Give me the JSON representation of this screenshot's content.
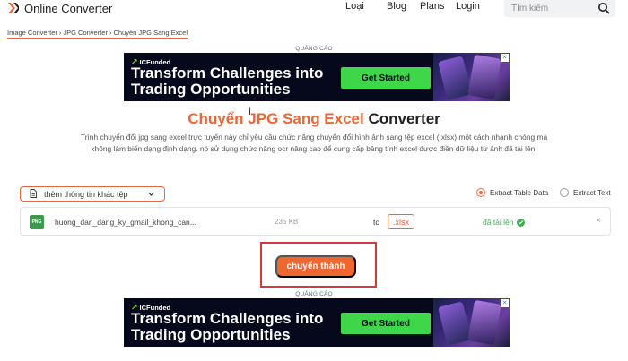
{
  "header": {
    "logo_text": "Online Converter",
    "nav": [
      "Loại",
      "Blog",
      "Plans",
      "Login"
    ],
    "search_placeholder": "Tìm kiếm"
  },
  "breadcrumb": [
    "Image Converter",
    "JPG Converter",
    "Chuyển JPG Sang Excel"
  ],
  "ads": {
    "label": "QUẢNG CÁO",
    "brand": "ICFunded",
    "headline": "Transform Challenges into Trading Opportunities",
    "cta": "Get Started",
    "close_glyph": "✕"
  },
  "title": {
    "accent": "Chuyển JPG Sang Excel",
    "rest": "Converter"
  },
  "description": "Trình chuyển đổi jpg sang excel trực tuyến này chỉ yêu cầu chức năng chuyển đổi hình ảnh sang tệp excel (.xlsx) một cách nhanh chóng mà không làm biến dạng định dạng. nó sử dụng chức năng ocr nâng cao để cung cấp bảng tính excel được điền dữ liệu từ ảnh đã tải lên.",
  "options": {
    "more_info_label": "thêm thông tin khác tệp",
    "extract_table": "Extract Table Data",
    "extract_text": "Extract Text",
    "selected": "Extract Table Data"
  },
  "file": {
    "type_badge": "PNG",
    "name": "huong_dan_dang_ky_gmail_khong_can...",
    "size": "235 KB",
    "to_label": "to",
    "target_format": ".xlsx",
    "status": "đã tải lên",
    "remove_glyph": "×"
  },
  "convert_label": "chuyển thành",
  "colors": {
    "accent": "#e8673a",
    "button": "#ed672f",
    "success": "#3fae55",
    "highlight": "#d7383a",
    "ad_bg": "#06091c",
    "ad_cta": "#3fd64a"
  }
}
